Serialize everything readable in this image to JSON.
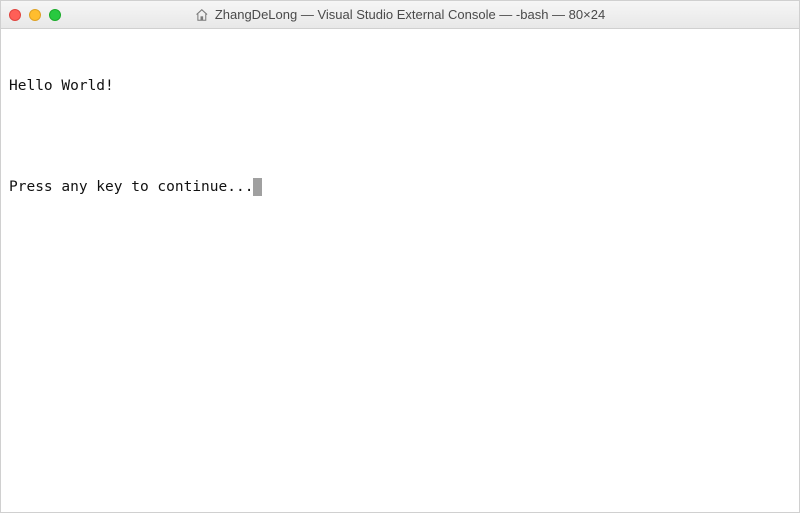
{
  "titlebar": {
    "title": "ZhangDeLong — Visual Studio External Console — -bash — 80×24"
  },
  "terminal": {
    "line1": "Hello World!",
    "blank": "",
    "line2": "Press any key to continue..."
  }
}
